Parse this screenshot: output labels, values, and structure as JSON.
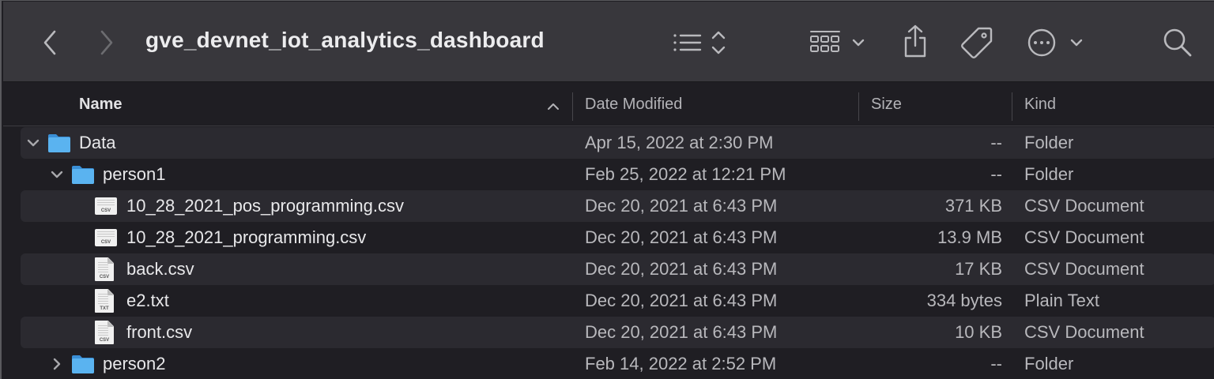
{
  "toolbar": {
    "title": "gve_devnet_iot_analytics_dashboard",
    "icons": [
      "chevron-left-icon",
      "chevron-right-icon",
      "list-view-icon",
      "grid-view-icon",
      "share-icon",
      "tag-icon",
      "more-icon",
      "search-icon"
    ]
  },
  "columns": {
    "name": "Name",
    "date": "Date Modified",
    "size": "Size",
    "kind": "Kind"
  },
  "rows": [
    {
      "name": "Data",
      "date": "Apr 15, 2022 at 2:30 PM",
      "size": "--",
      "kind": "Folder",
      "type": "folder",
      "expanded": true,
      "depth": 0
    },
    {
      "name": "person1",
      "date": "Feb 25, 2022 at 12:21 PM",
      "size": "--",
      "kind": "Folder",
      "type": "folder",
      "expanded": true,
      "depth": 1
    },
    {
      "name": "10_28_2021_pos_programming.csv",
      "date": "Dec 20, 2021 at 6:43 PM",
      "size": "371 KB",
      "kind": "CSV Document",
      "type": "csv-wide",
      "depth": 2,
      "badge": "CSV"
    },
    {
      "name": "10_28_2021_programming.csv",
      "date": "Dec 20, 2021 at 6:43 PM",
      "size": "13.9 MB",
      "kind": "CSV Document",
      "type": "csv-wide",
      "depth": 2,
      "badge": "CSV"
    },
    {
      "name": "back.csv",
      "date": "Dec 20, 2021 at 6:43 PM",
      "size": "17 KB",
      "kind": "CSV Document",
      "type": "csv",
      "depth": 2,
      "badge": "CSV"
    },
    {
      "name": "e2.txt",
      "date": "Dec 20, 2021 at 6:43 PM",
      "size": "334 bytes",
      "kind": "Plain Text",
      "type": "txt",
      "depth": 2,
      "badge": "TXT"
    },
    {
      "name": "front.csv",
      "date": "Dec 20, 2021 at 6:43 PM",
      "size": "10 KB",
      "kind": "CSV Document",
      "type": "csv",
      "depth": 2,
      "badge": "CSV"
    },
    {
      "name": "person2",
      "date": "Feb 14, 2022 at 2:52 PM",
      "size": "--",
      "kind": "Folder",
      "type": "folder",
      "expanded": false,
      "depth": 1
    }
  ],
  "colors": {
    "toolbar_bg": "#38373c",
    "window_bg": "#1f1e23",
    "alt_row_bg": "#2b2a30",
    "folder_blue": "#4aa3e8"
  }
}
